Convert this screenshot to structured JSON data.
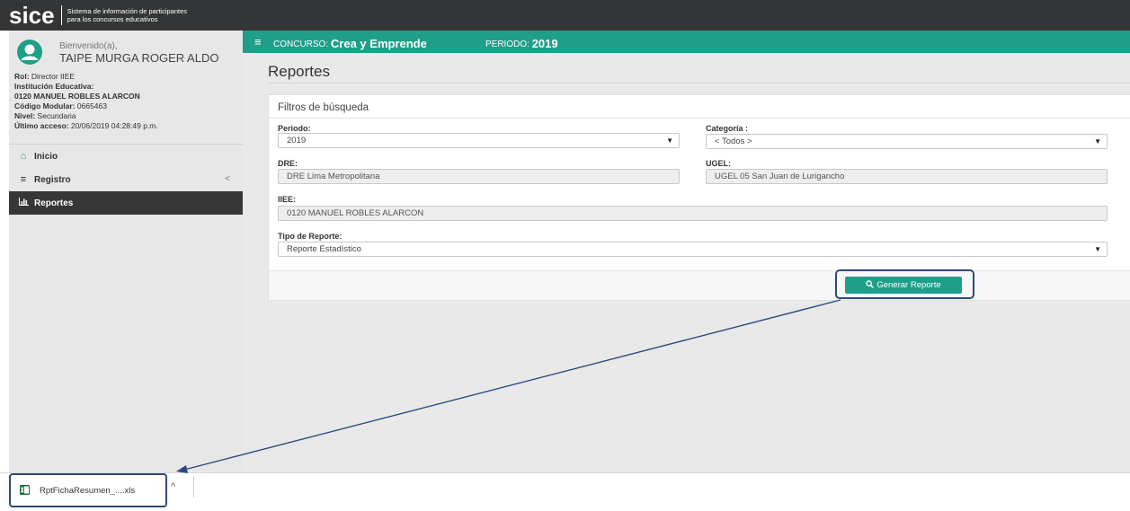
{
  "topbar": {
    "logo": "sice",
    "subtitle_line1": "Sistema de información de participantes",
    "subtitle_line2": "para los concursos educativos"
  },
  "sidebar": {
    "welcome": "Bienvenido(a),",
    "username": "TAIPE MURGA ROGER ALDO",
    "info": {
      "rol_label": "Rol:",
      "rol_value": "Director IIEE",
      "institucion_label": "Institución Educativa:",
      "institucion_value": "0120 MANUEL ROBLES ALARCON",
      "codigo_label": "Código Modular:",
      "codigo_value": "0665463",
      "nivel_label": "Nivel:",
      "nivel_value": "Secundaria",
      "acceso_label": "Último acceso:",
      "acceso_value": "20/06/2019 04:28:49 p.m."
    },
    "items": [
      {
        "label": "Inicio",
        "icon": "home-icon"
      },
      {
        "label": "Registro",
        "icon": "bars-icon",
        "chevron": "<"
      },
      {
        "label": "Reportes",
        "icon": "chart-icon",
        "active": true
      }
    ]
  },
  "header": {
    "hamburger": "≡",
    "concurso_label": "CONCURSO:",
    "concurso_value": "Crea y Emprende",
    "periodo_label": "PERIODO:",
    "periodo_value": "2019"
  },
  "main": {
    "page_title": "Reportes",
    "filters_title": "Filtros de búsqueda",
    "periodo_label": "Periodo:",
    "periodo_value": "2019",
    "categoria_label": "Categoría :",
    "categoria_value": "< Todos >",
    "dre_label": "DRE:",
    "dre_value": "DRE Lima Metropolitana",
    "ugel_label": "UGEL:",
    "ugel_value": "UGEL 05 San Juan de Lurigancho",
    "iiee_label": "IIEE:",
    "iiee_value": "0120 MANUEL ROBLES ALARCON",
    "tipo_label": "Tipo de Reporte:",
    "tipo_value": "Reporte Estadístico",
    "generate_button": "Generar Reporte"
  },
  "download_bar": {
    "file_name": "RptFichaResumen_....xls",
    "caret": "^"
  },
  "colors": {
    "accent": "#1f9e89",
    "topbar": "#333536",
    "sidebar": "#e7e7e7",
    "annotation": "#2b4a7a"
  }
}
